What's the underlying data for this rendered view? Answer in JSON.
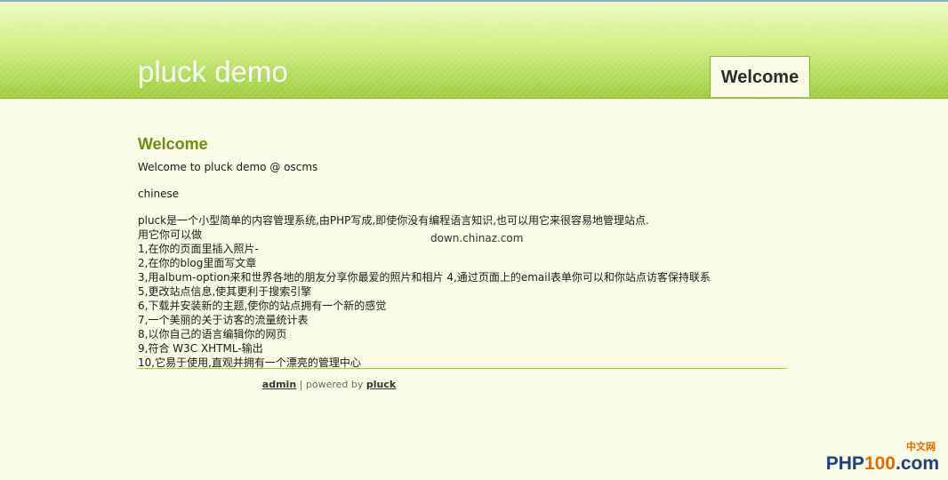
{
  "header": {
    "site_title": "pluck demo",
    "nav_tab": "Welcome"
  },
  "content": {
    "heading": "Welcome",
    "intro": "Welcome to pluck demo @ oscms",
    "lang": "chinese",
    "lines": [
      "pluck是一个小型简单的内容管理系统,由PHP写成,即使你没有编程语言知识,也可以用它来很容易地管理站点.",
      "用它你可以做",
      "1,在你的页面里插入照片-",
      "2,在你的blog里面写文章",
      "3,用album-option来和世界各地的朋友分享你最爱的照片和相片  4,通过页面上的email表单你可以和你站点访客保持联系",
      "5,更改站点信息,使其更利于搜索引擎",
      "6,下载并安装新的主题,使你的站点拥有一个新的感觉",
      "7,一个美丽的关于访客的流量统计表",
      "8,以你自己的语言编辑你的网页",
      "9,符合  W3C XHTML-输出",
      "10,它易于使用,直观并拥有一个漂亮的管理中心"
    ],
    "watermark": "down.chinaz.com"
  },
  "footer": {
    "admin_link": "admin",
    "separator": " | powered by ",
    "pluck_link": "pluck"
  },
  "logo": {
    "zh": "中文网",
    "brand_prefix": "PHP",
    "brand_num": "100",
    "brand_suffix": ".com"
  },
  "colors": {
    "accent_green": "#6b8e0f",
    "header_green": "#9ccd3c",
    "page_bg": "#fafbe6"
  }
}
